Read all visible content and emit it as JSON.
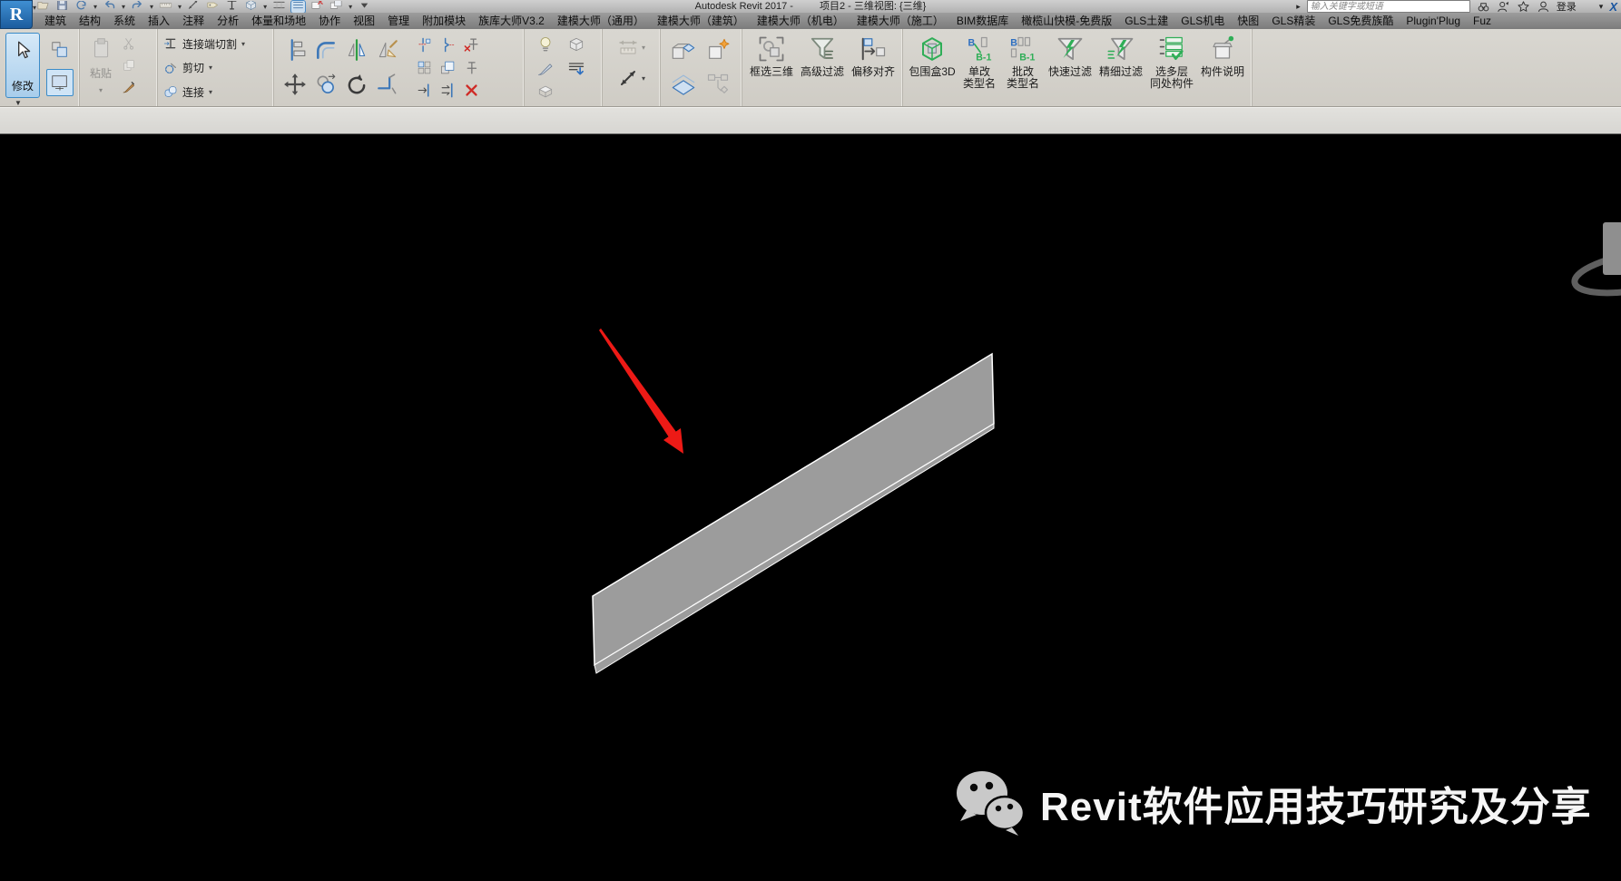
{
  "title_bar": {
    "app_title": "Autodesk Revit 2017 -",
    "document_title": "项目2 - 三维视图: {三维}",
    "search_placeholder": "输入关键字或短语",
    "sign_in_label": "登录",
    "icons": [
      "expand-arrow",
      "search-binoculars",
      "communication-center",
      "favorites-star",
      "sign-in-avatar",
      "dropdown",
      "exchange-apps"
    ]
  },
  "quick_access": {
    "icons": [
      "open",
      "save",
      "sync",
      "undo",
      "redo",
      "measure",
      "aligned-dimension",
      "tag",
      "text",
      "default-3d-view",
      "section",
      "thin-lines",
      "close-hidden-windows",
      "switch-windows",
      "customize"
    ]
  },
  "tabs": [
    "建筑",
    "结构",
    "系统",
    "插入",
    "注释",
    "分析",
    "体量和场地",
    "协作",
    "视图",
    "管理",
    "附加模块",
    "族库大师V3.2",
    "建模大师（通用）",
    "建模大师（建筑）",
    "建模大师（机电）",
    "建模大师（施工）",
    "BIM数据库",
    "橄榄山快模-免费版",
    "GLS土建",
    "GLS机电",
    "快图",
    "GLS精装",
    "GLS免费族酷",
    "Plugin'Plug",
    "Fuz"
  ],
  "ribbon": {
    "select": {
      "modify_label": "修改",
      "icons": [
        "select-boxes",
        "select-toggle"
      ]
    },
    "clipboard": {
      "paste_label": "粘贴",
      "icons": [
        "scissors",
        "copy-doc",
        "brush"
      ]
    },
    "geometry": {
      "items": [
        {
          "label": "连接端切割",
          "icon": "cope"
        },
        {
          "label": "剪切",
          "icon": "cut-geometry"
        },
        {
          "label": "连接",
          "icon": "join-geometry"
        }
      ]
    },
    "modify_tools": {
      "large": [
        "align",
        "offset",
        "mirror-pick",
        "mirror-draw",
        "move",
        "copy-element",
        "rotate",
        "corner-trim"
      ],
      "small": [
        "split",
        "gap-split",
        "unpin",
        "array",
        "scale",
        "pin",
        "trim-extend",
        "multi-trim",
        "delete"
      ]
    },
    "view": {
      "icons": [
        "lightbulb",
        "view-box-3d",
        "brush-override",
        "hide-lines",
        "section-box"
      ]
    },
    "measure": {
      "icons": [
        "dimension-horizontal",
        "dimension-diagonal"
      ]
    },
    "create": {
      "icons": [
        "cubes-pair",
        "cube-new",
        "sections-stack",
        "flow-diagram"
      ]
    },
    "plugin_a": [
      {
        "label": "框选三维",
        "icon": "box-select-3d"
      },
      {
        "label": "高级过滤",
        "icon": "advanced-filter"
      },
      {
        "label": "偏移对齐",
        "icon": "offset-align"
      }
    ],
    "plugin_b": [
      {
        "line1": "包围盒3D",
        "line2": "",
        "icon": "bounding-box-3d"
      },
      {
        "line1": "单改",
        "line2": "类型名",
        "icon": "rename-single"
      },
      {
        "line1": "批改",
        "line2": "类型名",
        "icon": "rename-batch"
      },
      {
        "line1": "快速过滤",
        "line2": "",
        "icon": "quick-filter"
      },
      {
        "line1": "精细过滤",
        "line2": "",
        "icon": "fine-filter"
      },
      {
        "line1": "选多层",
        "line2": "同处构件",
        "icon": "multi-layer"
      },
      {
        "line1": "构件说明",
        "line2": "",
        "icon": "component-note"
      }
    ]
  },
  "viewport": {
    "background": "#000000",
    "slab_color": "#9c9c9c",
    "slab_outline_color": "#ffffff",
    "arrow_color": "#ed1a16"
  },
  "watermark": {
    "text": "Revit软件应用技巧研究及分享",
    "icon": "wechat"
  }
}
